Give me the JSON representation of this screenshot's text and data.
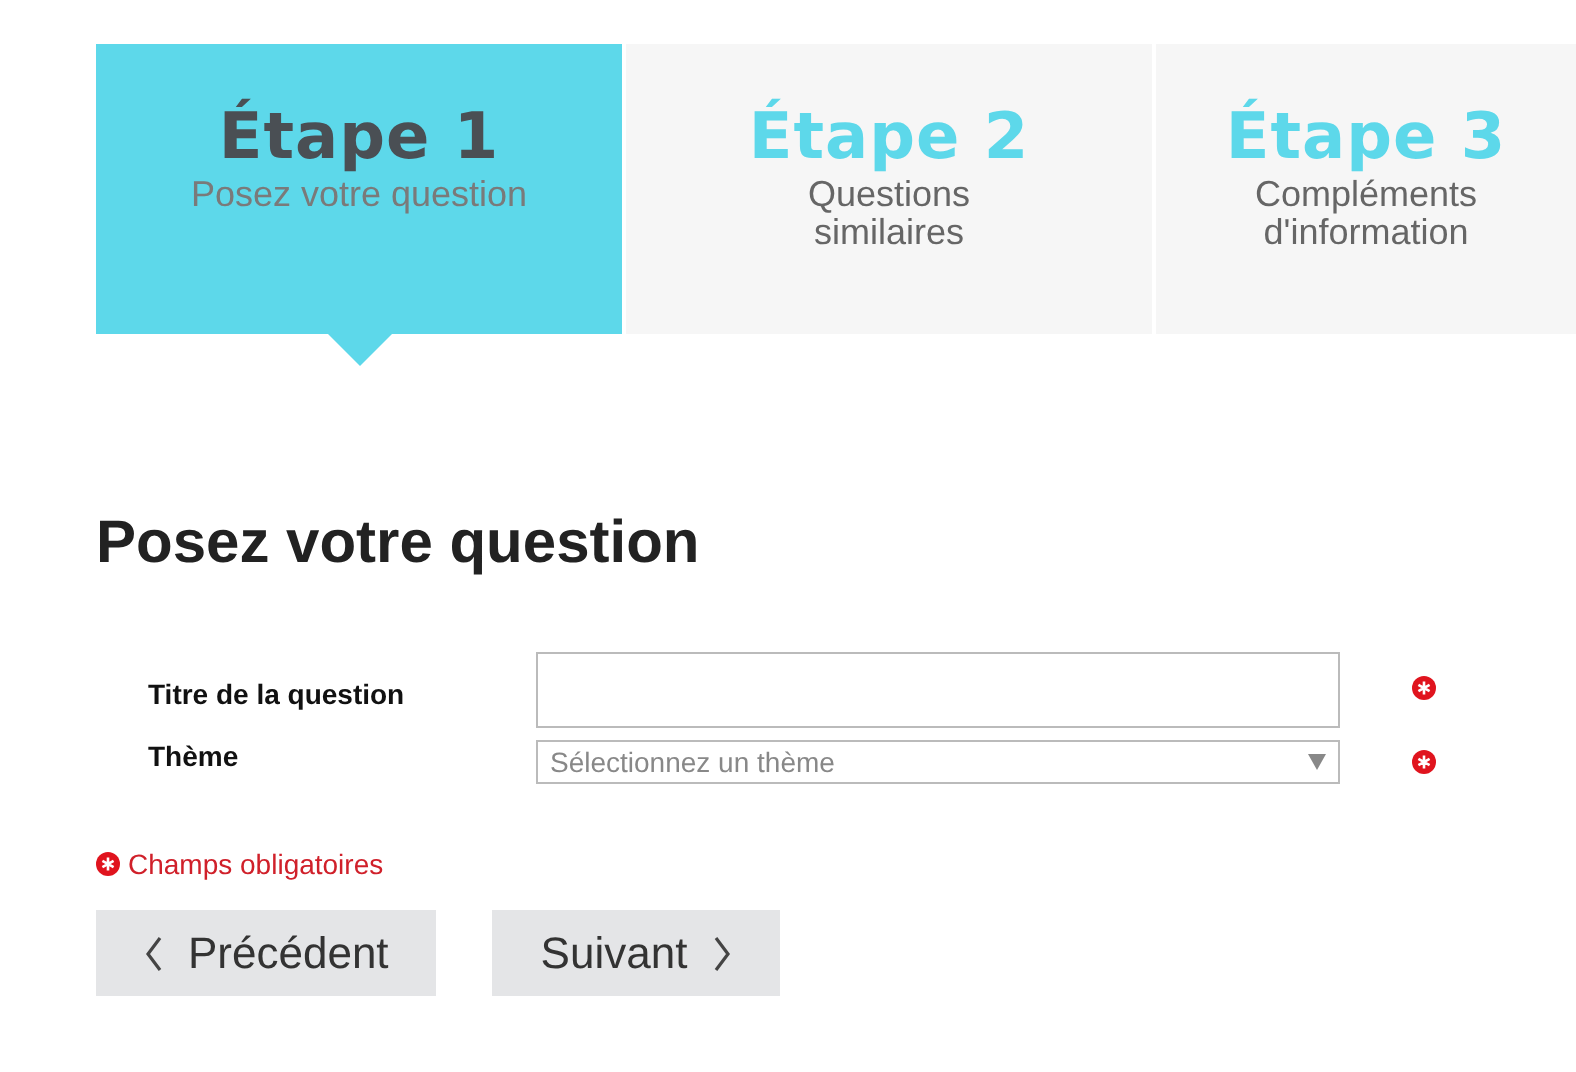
{
  "steps": [
    {
      "title": "Étape 1",
      "subtitle": "Posez votre question",
      "selected": true
    },
    {
      "title": "Étape 2",
      "subtitle": "Questions similaires",
      "selected": false
    },
    {
      "title": "Étape 3",
      "subtitle": "Compléments d'information",
      "selected": false
    }
  ],
  "heading": "Posez votre question",
  "fields": [
    {
      "label": "Titre de la question",
      "kind": "text",
      "required": true
    },
    {
      "label": "Thème",
      "kind": "select",
      "placeholder": "Sélectionnez un thème",
      "required": true
    }
  ],
  "legend": "Champs obligatoires",
  "buttons": [
    {
      "label": "Précédent",
      "kind": "previous"
    },
    {
      "label": "Suivant",
      "kind": "next"
    }
  ]
}
